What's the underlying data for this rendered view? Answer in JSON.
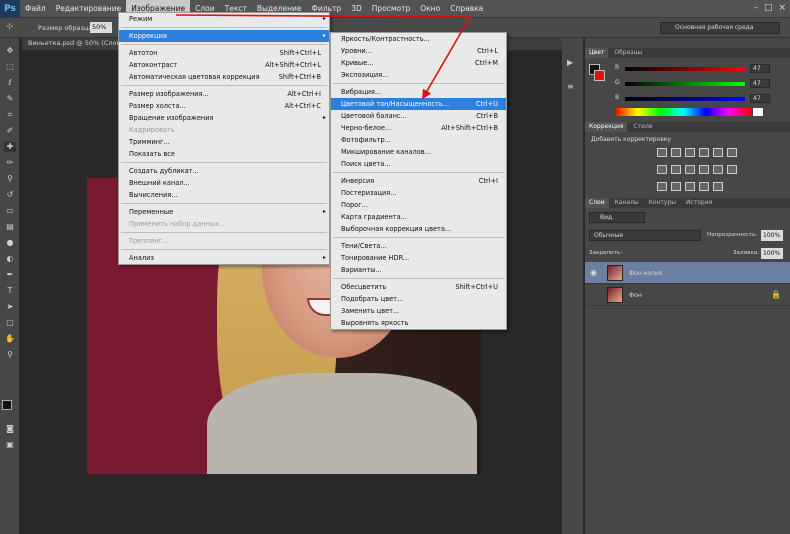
{
  "app_logo": "Ps",
  "menubar": [
    "Файл",
    "Редактирование",
    "Изображение",
    "Слои",
    "Текст",
    "Выделение",
    "Фильтр",
    "3D",
    "Просмотр",
    "Окно",
    "Справка"
  ],
  "window_controls": [
    "–",
    "□",
    "×"
  ],
  "options_bar": {
    "label": "Размер образца:",
    "value": "50%",
    "workspace": "Основная рабочая среда"
  },
  "document_tab": "Виньетка.psd @ 50% (Слой...",
  "image_menu": {
    "items": [
      {
        "label": "Режим",
        "shortcut": "",
        "submenu": true
      },
      {
        "label": "Коррекция",
        "shortcut": "",
        "submenu": true,
        "highlight": true
      },
      {
        "label": "Автотон",
        "shortcut": "Shift+Ctrl+L"
      },
      {
        "label": "Автоконтраст",
        "shortcut": "Alt+Shift+Ctrl+L"
      },
      {
        "label": "Автоматическая цветовая коррекция",
        "shortcut": "Shift+Ctrl+B"
      },
      {
        "label": "Размер изображения...",
        "shortcut": "Alt+Ctrl+I"
      },
      {
        "label": "Размер холста...",
        "shortcut": "Alt+Ctrl+C"
      },
      {
        "label": "Вращение изображения",
        "shortcut": "",
        "submenu": true
      },
      {
        "label": "Кадрировать",
        "shortcut": "",
        "disabled": true
      },
      {
        "label": "Тримминг...",
        "shortcut": ""
      },
      {
        "label": "Показать все",
        "shortcut": ""
      },
      {
        "label": "Создать дубликат...",
        "shortcut": ""
      },
      {
        "label": "Внешний канал...",
        "shortcut": ""
      },
      {
        "label": "Вычисления...",
        "shortcut": ""
      },
      {
        "label": "Переменные",
        "shortcut": "",
        "submenu": true
      },
      {
        "label": "Применить набор данных...",
        "shortcut": "",
        "disabled": true
      },
      {
        "label": "Треппинг...",
        "shortcut": "",
        "disabled": true
      },
      {
        "label": "Анализ",
        "shortcut": "",
        "submenu": true
      }
    ]
  },
  "correction_menu": {
    "items": [
      {
        "label": "Яркость/Контрастность...",
        "shortcut": ""
      },
      {
        "label": "Уровни...",
        "shortcut": "Ctrl+L"
      },
      {
        "label": "Кривые...",
        "shortcut": "Ctrl+M"
      },
      {
        "label": "Экспозиция...",
        "shortcut": ""
      },
      {
        "label": "Вибрация...",
        "shortcut": ""
      },
      {
        "label": "Цветовой тон/Насыщенность...",
        "shortcut": "Ctrl+U",
        "highlight": true
      },
      {
        "label": "Цветовой баланс...",
        "shortcut": "Ctrl+B"
      },
      {
        "label": "Черно-белое...",
        "shortcut": "Alt+Shift+Ctrl+B"
      },
      {
        "label": "Фотофильтр...",
        "shortcut": ""
      },
      {
        "label": "Микширование каналов...",
        "shortcut": ""
      },
      {
        "label": "Поиск цвета...",
        "shortcut": ""
      },
      {
        "label": "Инверсия",
        "shortcut": "Ctrl+I"
      },
      {
        "label": "Постеризация...",
        "shortcut": ""
      },
      {
        "label": "Порог...",
        "shortcut": ""
      },
      {
        "label": "Карта градиента...",
        "shortcut": ""
      },
      {
        "label": "Выборочная коррекция цвета...",
        "shortcut": ""
      },
      {
        "label": "Тени/Света...",
        "shortcut": ""
      },
      {
        "label": "Тонирование HDR...",
        "shortcut": ""
      },
      {
        "label": "Варианты...",
        "shortcut": ""
      },
      {
        "label": "Обесцветить",
        "shortcut": "Shift+Ctrl+U"
      },
      {
        "label": "Подобрать цвет...",
        "shortcut": ""
      },
      {
        "label": "Заменить цвет...",
        "shortcut": ""
      },
      {
        "label": "Выровнять яркость",
        "shortcut": ""
      }
    ]
  },
  "color_panel": {
    "tabs": [
      "Цвет",
      "Образцы"
    ],
    "channels": [
      {
        "name": "R",
        "value": "47",
        "gradient": "linear-gradient(90deg,#000,#f00)"
      },
      {
        "name": "G",
        "value": "47",
        "gradient": "linear-gradient(90deg,#000,#0f0)"
      },
      {
        "name": "B",
        "value": "47",
        "gradient": "linear-gradient(90deg,#000,#00f)"
      }
    ]
  },
  "adjustments_panel": {
    "tabs": [
      "Коррекция",
      "Стили"
    ],
    "title": "Добавить корректировку"
  },
  "layers_panel": {
    "tabs": [
      "Слои",
      "Каналы",
      "Контуры",
      "История"
    ],
    "filter_label": "Вид",
    "blend_mode": "Обычные",
    "opacity_label": "Непрозрачность:",
    "opacity_value": "100%",
    "lock_label": "Закрепить:",
    "fill_label": "Заливка:",
    "fill_value": "100%",
    "layers": [
      {
        "name": "Фон копия",
        "visible": true,
        "selected": true
      },
      {
        "name": "Фон",
        "visible": false,
        "selected": false
      }
    ]
  },
  "colors": {
    "accent": "#2f80dd",
    "menubar": "#535353",
    "panel": "#474747",
    "annotation_arrow": "#e01010"
  }
}
